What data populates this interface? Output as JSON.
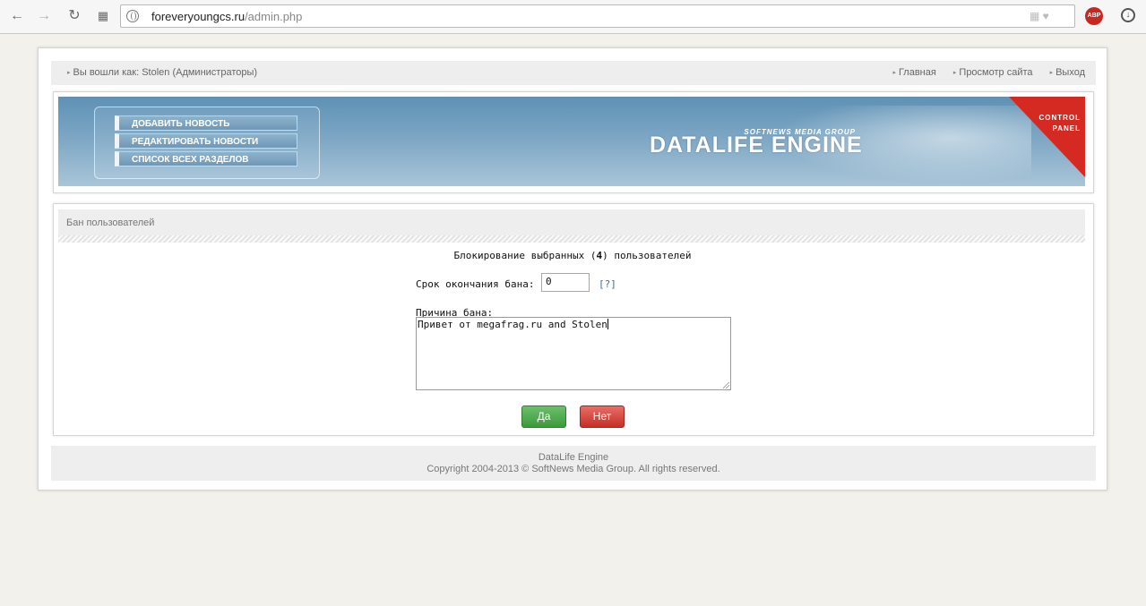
{
  "browser": {
    "url_domain": "foreveryoungcs.ru",
    "url_path": "/admin.php",
    "adblock_label": "ABP"
  },
  "topbar": {
    "logged_in": "Вы вошли как: Stolen (Администраторы)",
    "links": [
      "Главная",
      "Просмотр сайта",
      "Выход"
    ]
  },
  "banner": {
    "menu": [
      "ДОБАВИТЬ НОВОСТЬ",
      "РЕДАКТИРОВАТЬ НОВОСТИ",
      "СПИСОК ВСЕХ РАЗДЕЛОВ"
    ],
    "brand_sub": "SOFTNEWS MEDIA GROUP",
    "brand_main": "DATALIFE ENGINE",
    "corner_line1": "CONTROL",
    "corner_line2": "PANEL"
  },
  "section": {
    "title": "Бан пользователей",
    "heading_prefix": "Блокирование выбранных (",
    "heading_count": "4",
    "heading_suffix": ") пользователей",
    "term_label": "Срок окончания бана:",
    "term_value": "0",
    "help": "[?]",
    "reason_label": "Причина бана:",
    "reason_value": "Привет от megafrag.ru and Stolen",
    "yes": "Да",
    "no": "Нет"
  },
  "footer": {
    "line1": "DataLife Engine",
    "line2": "Copyright 2004-2013 © SoftNews Media Group. All rights reserved."
  }
}
